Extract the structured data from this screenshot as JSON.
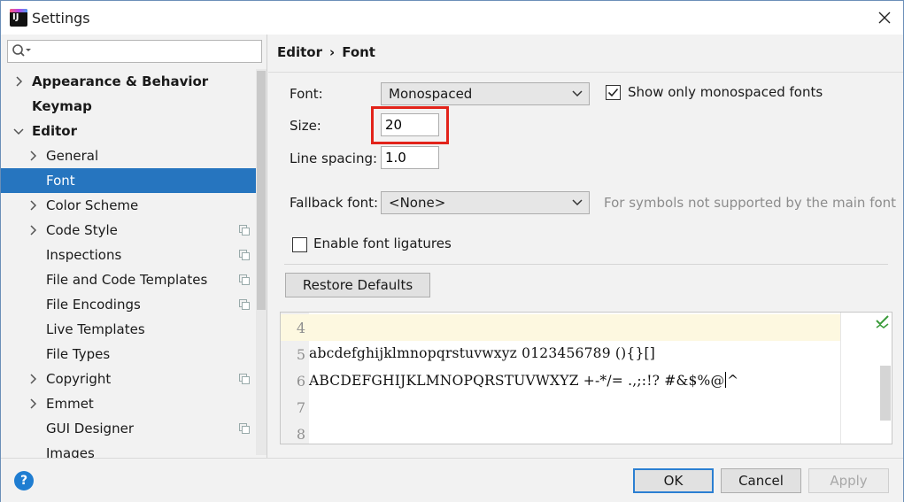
{
  "window": {
    "title": "Settings"
  },
  "search": {
    "value": "",
    "placeholder": ""
  },
  "sidebar": {
    "items": [
      {
        "label": "Appearance & Behavior",
        "level": 0,
        "bold": true,
        "expander": "collapsed",
        "copy": false
      },
      {
        "label": "Keymap",
        "level": 0,
        "bold": true,
        "expander": "none",
        "copy": false
      },
      {
        "label": "Editor",
        "level": 0,
        "bold": true,
        "expander": "expanded",
        "copy": false
      },
      {
        "label": "General",
        "level": 1,
        "bold": false,
        "expander": "collapsed",
        "copy": false
      },
      {
        "label": "Font",
        "level": 1,
        "bold": false,
        "expander": "none",
        "copy": false,
        "selected": true
      },
      {
        "label": "Color Scheme",
        "level": 1,
        "bold": false,
        "expander": "collapsed",
        "copy": false
      },
      {
        "label": "Code Style",
        "level": 1,
        "bold": false,
        "expander": "collapsed",
        "copy": true
      },
      {
        "label": "Inspections",
        "level": 1,
        "bold": false,
        "expander": "none",
        "copy": true
      },
      {
        "label": "File and Code Templates",
        "level": 1,
        "bold": false,
        "expander": "none",
        "copy": true
      },
      {
        "label": "File Encodings",
        "level": 1,
        "bold": false,
        "expander": "none",
        "copy": true
      },
      {
        "label": "Live Templates",
        "level": 1,
        "bold": false,
        "expander": "none",
        "copy": false
      },
      {
        "label": "File Types",
        "level": 1,
        "bold": false,
        "expander": "none",
        "copy": false
      },
      {
        "label": "Copyright",
        "level": 1,
        "bold": false,
        "expander": "collapsed",
        "copy": true
      },
      {
        "label": "Emmet",
        "level": 1,
        "bold": false,
        "expander": "collapsed",
        "copy": false
      },
      {
        "label": "GUI Designer",
        "level": 1,
        "bold": false,
        "expander": "none",
        "copy": true
      },
      {
        "label": "Images",
        "level": 1,
        "bold": false,
        "expander": "none",
        "copy": false
      }
    ]
  },
  "breadcrumb": {
    "parent": "Editor",
    "separator": "›",
    "current": "Font"
  },
  "font_settings": {
    "font_label": "Font:",
    "font_value": "Monospaced",
    "show_mono_label": "Show only monospaced fonts",
    "show_mono_checked": true,
    "size_label": "Size:",
    "size_value": "20",
    "line_spacing_label": "Line spacing:",
    "line_spacing_value": "1.0",
    "fallback_label": "Fallback font:",
    "fallback_value": "<None>",
    "fallback_hint": "For symbols not supported by the main font",
    "ligatures_label": "Enable font ligatures",
    "ligatures_checked": false,
    "restore_label": "Restore Defaults"
  },
  "preview": {
    "lines": [
      {
        "num": "4",
        "text": ""
      },
      {
        "num": "5",
        "text": "abcdefghijklmnopqrstuvwxyz 0123456789 (){}[]"
      },
      {
        "num": "6",
        "text_before": "ABCDEFGHIJKLMNOPQRSTUVWXYZ +-*/= .,;:!? #&$%@",
        "text_after": "^"
      },
      {
        "num": "7",
        "text": ""
      },
      {
        "num": "8",
        "text": ""
      }
    ]
  },
  "buttons": {
    "ok": "OK",
    "cancel": "Cancel",
    "apply": "Apply",
    "help": "?"
  },
  "colors": {
    "selection": "#2675bf",
    "highlight": "#e2231a",
    "primary_border": "#2b7fd2"
  }
}
